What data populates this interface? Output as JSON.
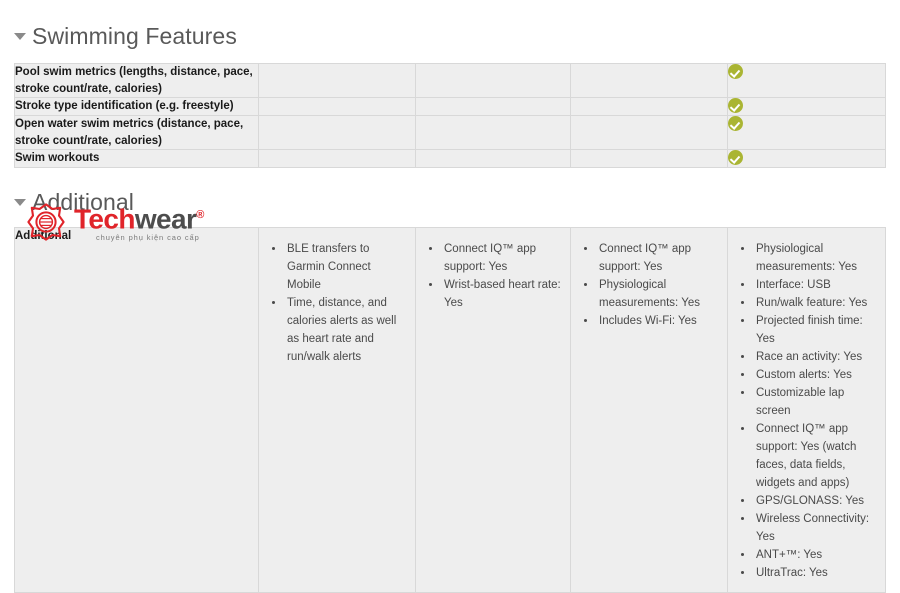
{
  "sections": [
    {
      "id": "swimming-features",
      "heading": "Swimming Features",
      "caret_icon": "caret-down-icon",
      "rows": [
        {
          "label": "Pool swim metrics (lengths, distance, pace, stroke count/rate, calories)",
          "cells": [
            "",
            "",
            "",
            "check"
          ]
        },
        {
          "label": "Stroke type identification (e.g. freestyle)",
          "cells": [
            "",
            "",
            "",
            "check"
          ]
        },
        {
          "label": "Open water swim metrics (distance, pace, stroke count/rate, calories)",
          "cells": [
            "",
            "",
            "",
            "check"
          ]
        },
        {
          "label": "Swim workouts",
          "cells": [
            "",
            "",
            "",
            "check"
          ]
        }
      ]
    },
    {
      "id": "additional",
      "heading": "Additional",
      "caret_icon": "caret-down-icon",
      "row_label": "Additional",
      "columns": [
        {
          "name": "column-1",
          "items": [
            "BLE transfers to Garmin Connect Mobile",
            "Time, distance, and calories alerts as well as heart rate and run/walk alerts"
          ]
        },
        {
          "name": "column-2",
          "items": [
            "Connect IQ™ app support: Yes",
            "Wrist-based heart rate: Yes"
          ]
        },
        {
          "name": "column-3",
          "items": [
            "Connect IQ™ app support: Yes",
            "Physiological measurements: Yes",
            "Includes Wi-Fi: Yes"
          ]
        },
        {
          "name": "column-4",
          "items": [
            "Physiological measurements: Yes",
            "Interface: USB",
            "Run/walk feature: Yes",
            "Projected finish time: Yes",
            "Race an activity: Yes",
            "Custom alerts: Yes",
            "Customizable lap screen",
            "Connect IQ™ app support: Yes (watch faces, data fields, widgets and apps)",
            "GPS/GLONASS: Yes",
            "Wireless Connectivity: Yes",
            "ANT+™: Yes",
            "UltraTrac: Yes"
          ]
        }
      ]
    }
  ],
  "logo": {
    "icon": "techwear-gear-icon",
    "word_first": "Tech",
    "word_second": "wear",
    "registered_mark": "®",
    "tagline": "chuyên phụ kiện cao cấp",
    "color_primary": "#e0242a",
    "color_secondary": "#4d4d4d"
  },
  "colors": {
    "check_green": "#aab533",
    "cell_background": "#eeeeee",
    "cell_border": "#d8d8d8",
    "heading_text": "#595959"
  }
}
